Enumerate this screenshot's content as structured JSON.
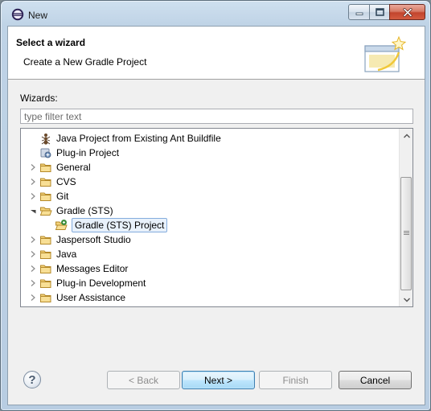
{
  "window": {
    "title": "New",
    "app_icon": "eclipse-icon"
  },
  "banner": {
    "title": "Select a wizard",
    "description": "Create a New Gradle Project",
    "image": "wizard-banner-icon"
  },
  "wizards_label": "Wizards:",
  "filter": {
    "placeholder": "type filter text",
    "value": ""
  },
  "tree": {
    "items": [
      {
        "label": "Java Project from Existing Ant Buildfile",
        "icon": "ant-project-icon",
        "expandable": false,
        "expanded": false,
        "level": 1,
        "selected": false
      },
      {
        "label": "Plug-in Project",
        "icon": "plugin-project-icon",
        "expandable": false,
        "expanded": false,
        "level": 1,
        "selected": false
      },
      {
        "label": "General",
        "icon": "folder-icon",
        "expandable": true,
        "expanded": false,
        "level": 0,
        "selected": false
      },
      {
        "label": "CVS",
        "icon": "folder-icon",
        "expandable": true,
        "expanded": false,
        "level": 0,
        "selected": false
      },
      {
        "label": "Git",
        "icon": "folder-icon",
        "expandable": true,
        "expanded": false,
        "level": 0,
        "selected": false
      },
      {
        "label": "Gradle (STS)",
        "icon": "folder-open-icon",
        "expandable": true,
        "expanded": true,
        "level": 0,
        "selected": false
      },
      {
        "label": "Gradle (STS) Project",
        "icon": "gradle-project-icon",
        "expandable": false,
        "expanded": false,
        "level": 1,
        "selected": true
      },
      {
        "label": "Jaspersoft Studio",
        "icon": "folder-icon",
        "expandable": true,
        "expanded": false,
        "level": 0,
        "selected": false
      },
      {
        "label": "Java",
        "icon": "folder-icon",
        "expandable": true,
        "expanded": false,
        "level": 0,
        "selected": false
      },
      {
        "label": "Messages Editor",
        "icon": "folder-icon",
        "expandable": true,
        "expanded": false,
        "level": 0,
        "selected": false
      },
      {
        "label": "Plug-in Development",
        "icon": "folder-icon",
        "expandable": true,
        "expanded": false,
        "level": 0,
        "selected": false
      },
      {
        "label": "User Assistance",
        "icon": "folder-icon",
        "expandable": true,
        "expanded": false,
        "level": 0,
        "selected": false
      }
    ]
  },
  "buttons": {
    "help_icon": "help-icon",
    "back": "< Back",
    "next": "Next >",
    "finish": "Finish",
    "cancel": "Cancel"
  },
  "colors": {
    "selection_fill": "#e8f1fb",
    "selection_border": "#84acdd",
    "default_button_border": "#3c7fb1",
    "close_button": "#c2452d"
  }
}
